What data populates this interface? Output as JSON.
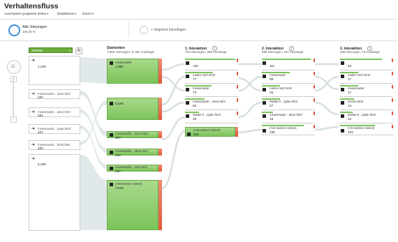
{
  "title": "Verhaltensfluss",
  "toolbar": {
    "item1": "Automatisch gruppierte Seiten",
    "item2": "Detailebene",
    "item3": "Export"
  },
  "segments": {
    "seg1_title": "Alle Sitzungen",
    "seg1_sub": "100,00 %",
    "seg2": "+ Segment hinzufügen"
  },
  "dimension": "Zielseite",
  "sources": [
    {
      "label": "",
      "value": "1,34K"
    },
    {
      "label": "/newsreader…inten.html",
      "value": "297"
    },
    {
      "label": "/newsreader…ation.html",
      "value": "251"
    },
    {
      "label": "/newsreader…page.html",
      "value": "247"
    },
    {
      "label": "/newsreader…think.html",
      "value": "220"
    },
    {
      "label": "",
      "value": "5,19K"
    }
  ],
  "columns": {
    "start": {
      "title": "Startseiten",
      "sub": "7,55K Sitzungen, 6,76K Ausstiege"
    },
    "i1": {
      "title": "1. Interaktion",
      "sub": "793 Sitzungen, 396 Ausstiege"
    },
    "i2": {
      "title": "2. Interaktion",
      "sub": "395 Sitzungen, 187 Ausstiege"
    },
    "i3": {
      "title": "3. Interaktion",
      "sub": "208 Sitzungen, 73 Ausstiege"
    }
  },
  "start_nodes": [
    {
      "label": "/newsreader",
      "value": "1,88K"
    },
    {
      "label": "",
      "value": "5,04K"
    },
    {
      "label": "/newsreader…inten.html",
      "value": "297"
    },
    {
      "label": "/newsreader…ation.html",
      "value": "252"
    },
    {
      "label": "/newsreader…start.html",
      "value": "257"
    },
    {
      "label": "(>58 weitere Seiten)",
      "value": "3,52K"
    }
  ],
  "i1_nodes": [
    {
      "label": "",
      "value": "140"
    },
    {
      "label": "/ueber-mich.html",
      "value": "77"
    },
    {
      "label": "/newsreader",
      "value": "73"
    },
    {
      "label": "/newsreader…ation.html",
      "value": "52"
    },
    {
      "label": "/twitter-li…splan.html",
      "value": "36"
    },
    {
      "label": "(>45 weitere Seiten)",
      "value": "402"
    }
  ],
  "i2_nodes": [
    {
      "label": "",
      "value": "111"
    },
    {
      "label": "/newsreader",
      "value": "58"
    },
    {
      "label": "/ueber-mich.html",
      "value": "26"
    },
    {
      "label": "/twitter-li…splan.html",
      "value": "27"
    },
    {
      "label": "/newsreader…ation.html",
      "value": "16"
    },
    {
      "label": "(>42 weitere Seiten)",
      "value": "155"
    }
  ],
  "i3_nodes": [
    {
      "label": "",
      "value": "46"
    },
    {
      "label": "/ueber-mich.html",
      "value": "17"
    },
    {
      "label": "/newsreader",
      "value": "17"
    },
    {
      "label": "/suche.html",
      "value": "14"
    },
    {
      "label": "/twitter-li…splan.html",
      "value": "12"
    },
    {
      "label": "(>33 weitere Seiten)",
      "value": "103"
    }
  ]
}
